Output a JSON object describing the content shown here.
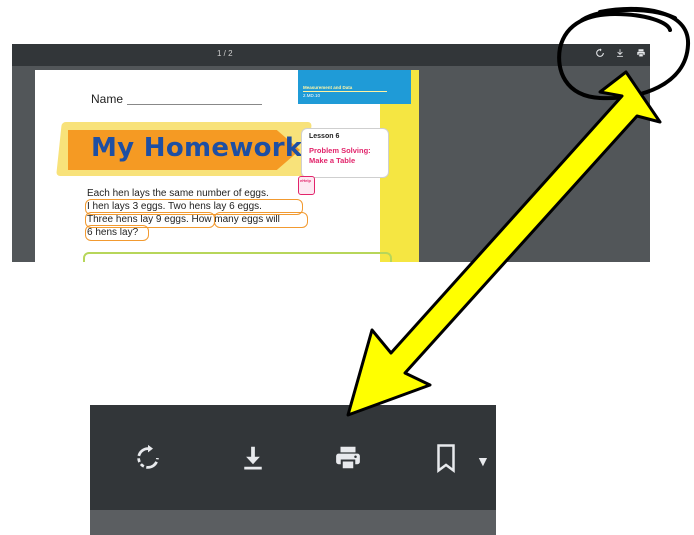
{
  "viewer": {
    "page_counter": "1 / 2",
    "toolbar_icons": [
      "rotate-icon",
      "download-icon",
      "print-icon"
    ]
  },
  "worksheet": {
    "name_label": "Name",
    "band": {
      "line1": "Measurement and Data",
      "line2": "2.MD.10"
    },
    "banner_title": "My Homework",
    "lesson": {
      "number": "Lesson 6",
      "title_line1": "Problem Solving:",
      "title_line2": "Make a Table"
    },
    "ehelp_label": "eHelp",
    "problem_lines": [
      "Each hen lays the same number of eggs.",
      "I hen lays 3 eggs. Two hens lay 6 eggs.",
      "Three hens lay 9 eggs. How many eggs will",
      "6 hens lay?"
    ]
  },
  "zoomed_toolbar": {
    "icons": [
      "rotate-icon",
      "download-icon",
      "print-icon",
      "bookmark-icon",
      "chevron-down-icon"
    ]
  },
  "annotation": {
    "arrow_color": "#ffff00",
    "outline_color": "#000000"
  }
}
